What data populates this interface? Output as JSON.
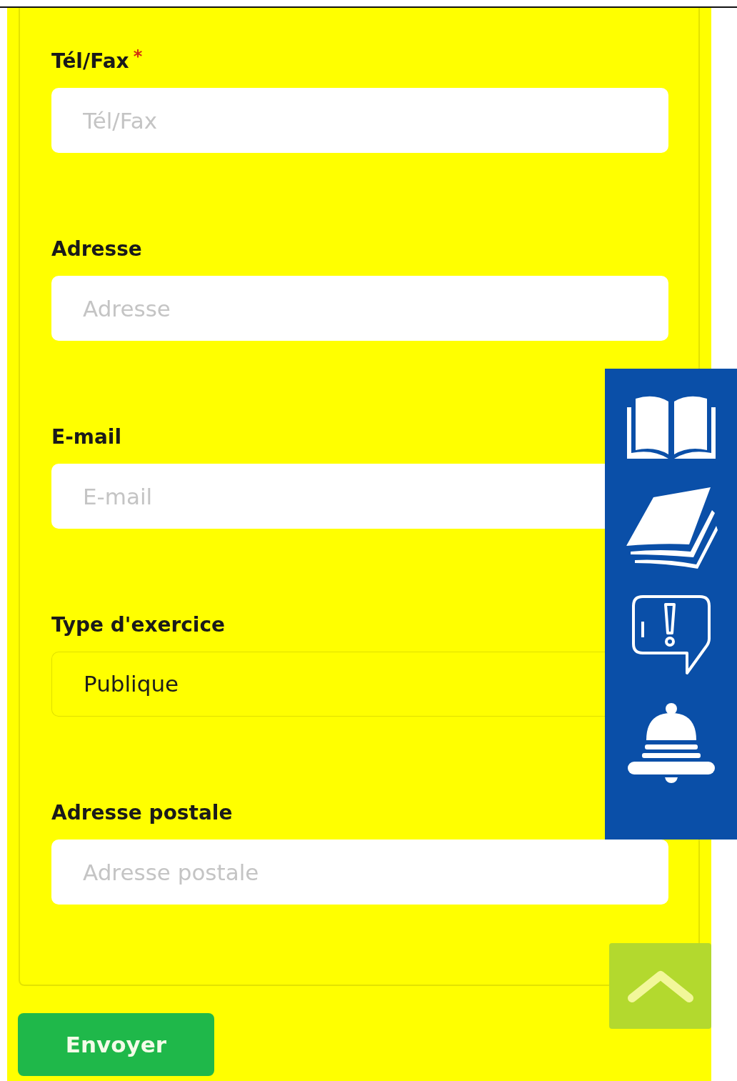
{
  "fields": [
    {
      "label": "Tél/Fax",
      "required_mark": "*",
      "kind": "text",
      "placeholder": "Tél/Fax"
    },
    {
      "label": "Adresse",
      "kind": "text",
      "placeholder": "Adresse"
    },
    {
      "label": "E-mail",
      "kind": "text",
      "placeholder": "E-mail"
    },
    {
      "label": "Type d'exercice",
      "kind": "select",
      "value": "Publique"
    },
    {
      "label": "Adresse postale",
      "kind": "text",
      "placeholder": "Adresse postale"
    }
  ],
  "submit": "Envoyer"
}
